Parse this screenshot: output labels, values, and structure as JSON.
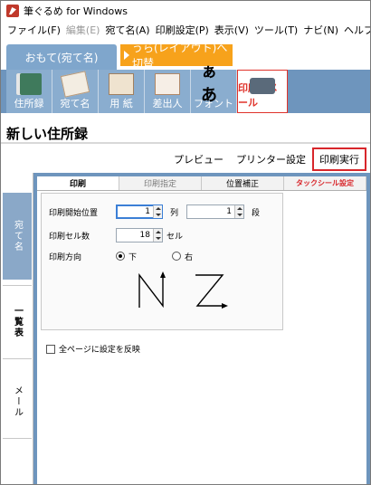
{
  "window": {
    "title": "筆ぐるめ for Windows"
  },
  "menu": [
    {
      "label": "ファイル(F)",
      "enabled": true
    },
    {
      "label": "編集(E)",
      "enabled": false
    },
    {
      "label": "宛て名(A)",
      "enabled": true
    },
    {
      "label": "印刷設定(P)",
      "enabled": true
    },
    {
      "label": "表示(V)",
      "enabled": true
    },
    {
      "label": "ツール(T)",
      "enabled": true
    },
    {
      "label": "ナビ(N)",
      "enabled": true
    },
    {
      "label": "ヘルプ(H)",
      "enabled": true
    }
  ],
  "mode_tabs": {
    "front": "おもて(宛て名)",
    "back": "うら(レイアウト)へ切替"
  },
  "toolbar": [
    {
      "label": "住所録",
      "icon": "address-book-icon"
    },
    {
      "label": "宛て名",
      "icon": "address-card-icon"
    },
    {
      "label": "用 紙",
      "icon": "paper-icon"
    },
    {
      "label": "差出人",
      "icon": "sender-icon"
    },
    {
      "label": "フォント",
      "icon": "font-icon",
      "glyph": "ぁあ"
    },
    {
      "label": "印刷・メール",
      "icon": "printer-icon",
      "active": true
    }
  ],
  "page": {
    "title": "新しい住所録"
  },
  "actions": {
    "preview": "プレビュー",
    "printer_settings": "プリンター設定",
    "execute": "印刷実行"
  },
  "side_tabs": [
    "宛て名",
    "一覧表",
    "メール"
  ],
  "dialog": {
    "tabs": [
      {
        "label": "印刷",
        "state": "active"
      },
      {
        "label": "印刷指定",
        "state": "dim"
      },
      {
        "label": "位置補正",
        "state": "normal"
      },
      {
        "label": "タックシール設定",
        "state": "red"
      }
    ],
    "start_position_label": "印刷開始位置",
    "row_value": "1",
    "row_unit": "列",
    "column_value": "1",
    "column_unit": "段",
    "cell_count_label": "印刷セル数",
    "cell_count_value": "18",
    "cell_count_unit": "セル",
    "direction_label": "印刷方向",
    "direction_down": "下",
    "direction_right": "右",
    "direction_selected": "down",
    "apply_all_pages_label": "全ページに設定を反映"
  },
  "colors": {
    "accent_red": "#d8262b",
    "toolbar_blue": "#6e95bd",
    "back_tab_orange": "#f7a21b"
  }
}
